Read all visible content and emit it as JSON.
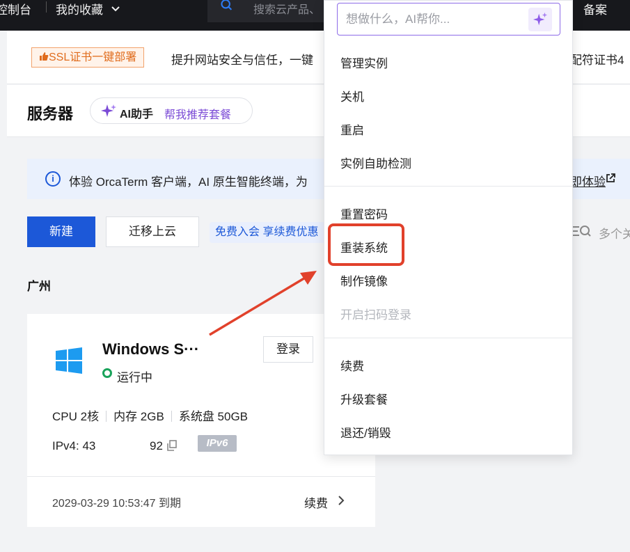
{
  "topbar": {
    "console_label": "控制台",
    "favorites_label": "我的收藏",
    "search_placeholder": "搜索云产品、",
    "right_label": "备案"
  },
  "banner": {
    "tag_label": "SSL证书一键部署",
    "text": "提升网站安全与信任，一键",
    "text_tail": "配符证书4"
  },
  "header": {
    "title": "服务器",
    "ai_label": "AI助手",
    "ai_action": "帮我推荐套餐"
  },
  "notice": {
    "text": "体验 OrcaTerm 客户端，AI 原生智能终端，为",
    "link": "即体验"
  },
  "toolbar": {
    "new_label": "新建",
    "migrate_label": "迁移上云",
    "promo_label": "免费入会 享续费优惠",
    "filter_placeholder": "多个关"
  },
  "region": "广州",
  "instance": {
    "name": "Windows S···",
    "status": "运行中",
    "login_label": "登录",
    "cpu": "CPU 2核",
    "memory": "内存 2GB",
    "disk": "系统盘 50GB",
    "ipv4_prefix": "IPv4: 43",
    "ipv4_suffix": "92",
    "ipv6_badge": "IPv6",
    "expire": "2029-03-29 10:53:47 到期",
    "renew_label": "续费",
    "status_color": "#1aa35b"
  },
  "dropdown": {
    "ai_placeholder": "想做什么，AI帮你...",
    "groups": [
      [
        "管理实例",
        "关机",
        "重启",
        "实例自助检测"
      ],
      [
        "重置密码",
        "重装系统",
        "制作镜像",
        "开启扫码登录"
      ],
      [
        "续费",
        "升级套餐",
        "退还/销毁"
      ]
    ],
    "disabled_item": "开启扫码登录",
    "highlighted_item": "重装系统"
  },
  "colors": {
    "primary": "#1c58d8",
    "ai_purple": "#7b4bd6",
    "highlight_red": "#e1412b",
    "topbar_bg": "#17181c"
  }
}
